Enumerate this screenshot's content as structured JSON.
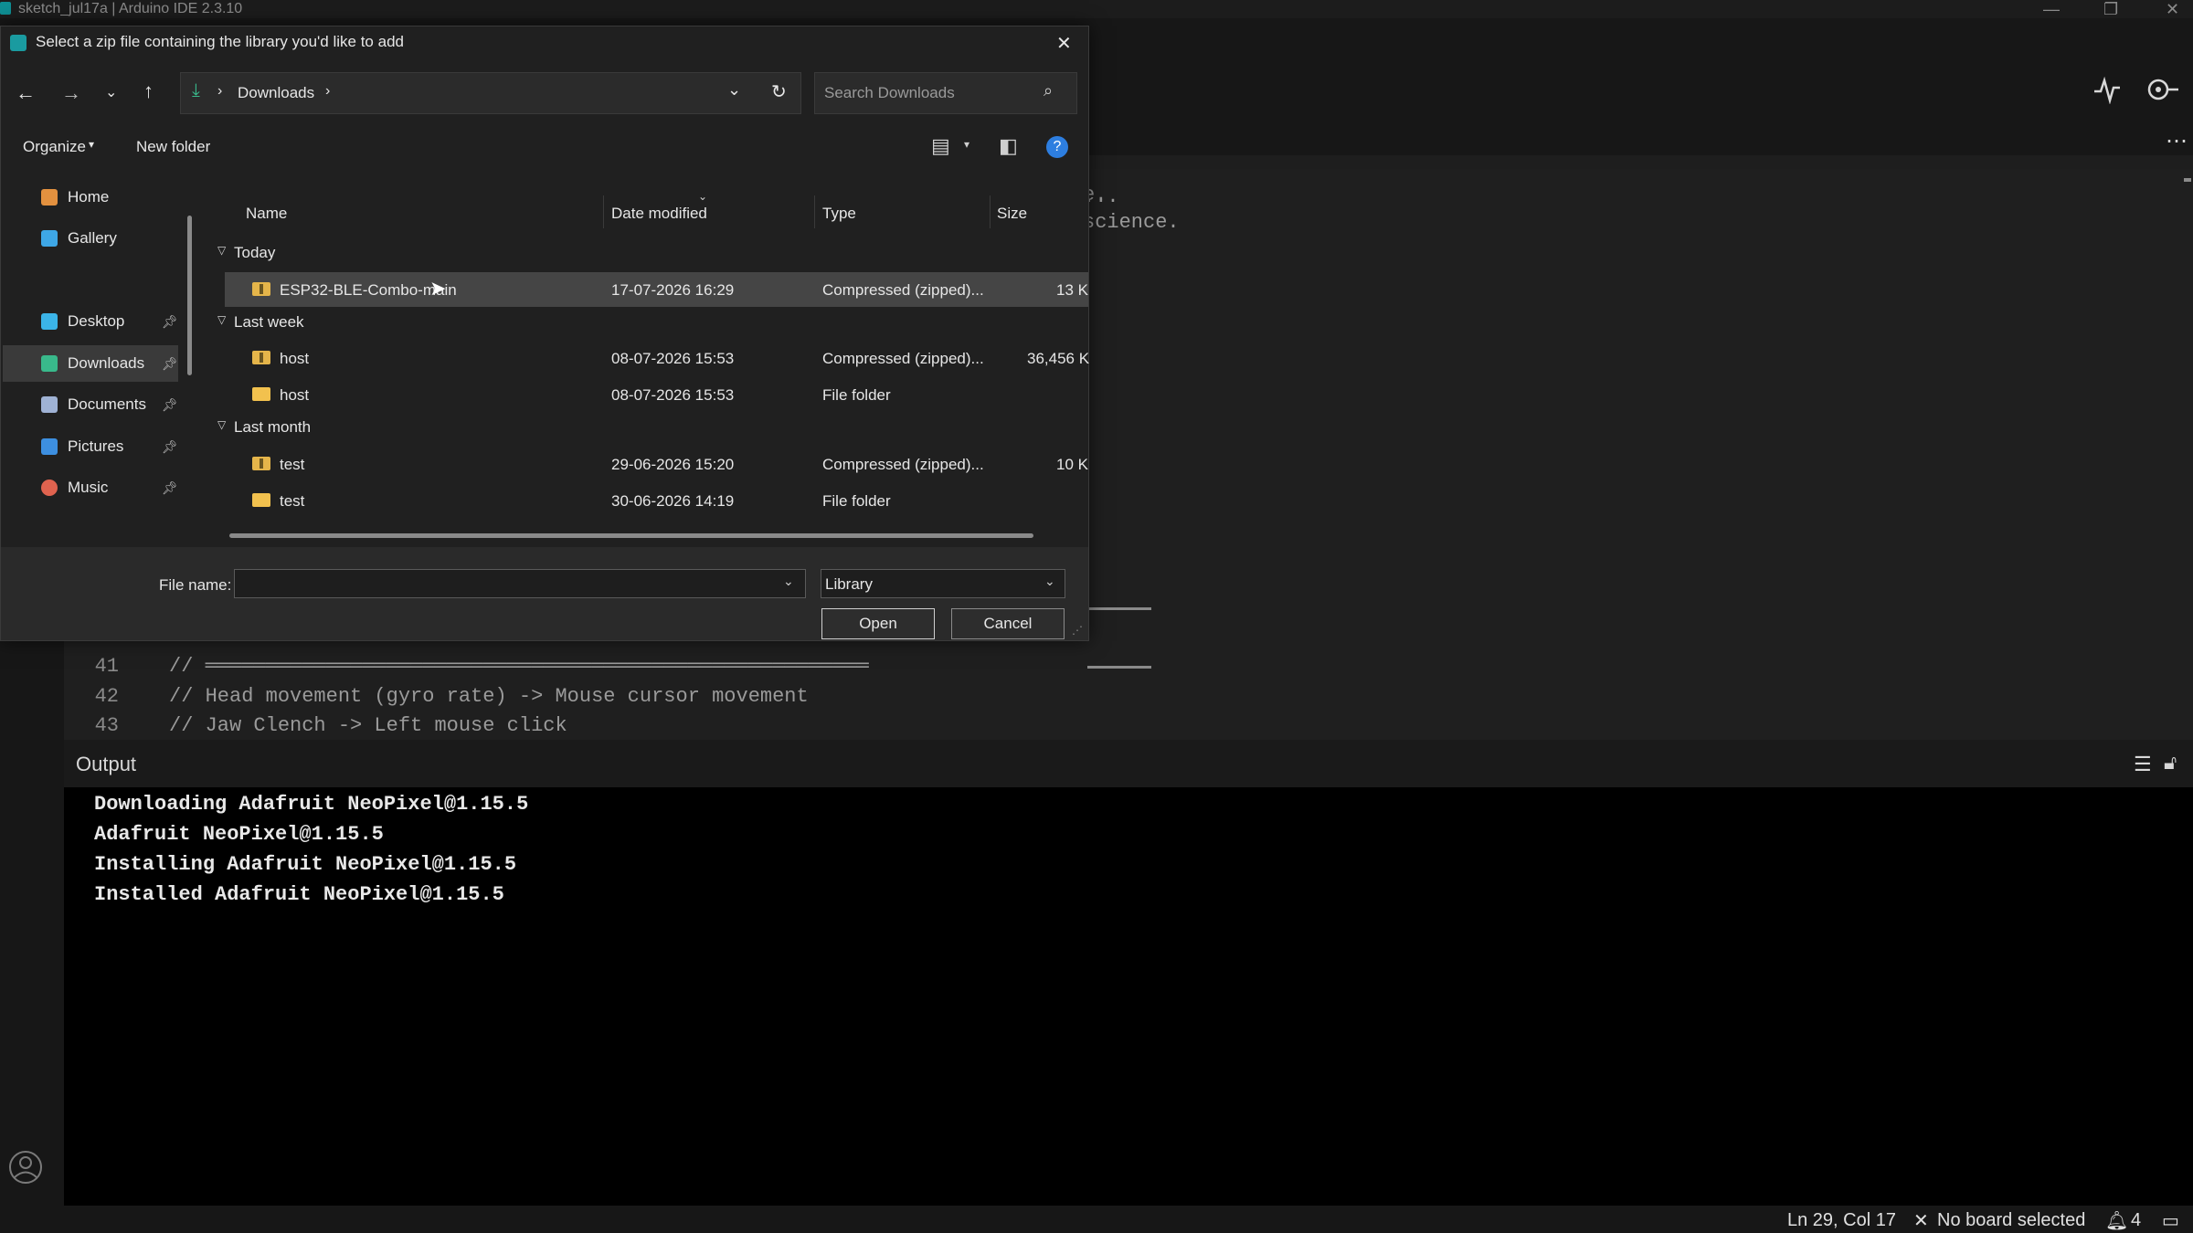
{
  "ide": {
    "window_title": "sketch_jul17a | Arduino IDE 2.3.10",
    "code_lines": [
      {
        "num": "41",
        "text": "// ═══════════════════════════════════════════════════════"
      },
      {
        "num": "42",
        "text": "// Head movement (gyro rate) -> Mouse cursor movement"
      },
      {
        "num": "43",
        "text": "// Jaw Clench -> Left mouse click"
      }
    ],
    "partial_code_1": "e.",
    "partial_code_2": "science.",
    "output_title": "Output",
    "output_lines": [
      "Downloading Adafruit NeoPixel@1.15.5",
      "Adafruit NeoPixel@1.15.5",
      "Installing Adafruit NeoPixel@1.15.5",
      "Installed Adafruit NeoPixel@1.15.5"
    ],
    "status": {
      "cursor": "Ln 29, Col 17",
      "board": "No board selected",
      "notifications": "4"
    }
  },
  "dialog": {
    "title": "Select a zip file containing the library you'd like to add",
    "breadcrumb": "Downloads",
    "search_placeholder": "Search Downloads",
    "organize_label": "Organize",
    "new_folder_label": "New folder",
    "nav": [
      {
        "label": "Home",
        "color": "#e3913f",
        "pinned": false
      },
      {
        "label": "Gallery",
        "color": "#3ea7e6",
        "pinned": false
      },
      {
        "label": "Desktop",
        "color": "#3bb4e8",
        "pinned": true
      },
      {
        "label": "Downloads",
        "color": "#39b98b",
        "pinned": true
      },
      {
        "label": "Documents",
        "color": "#9fb2d4",
        "pinned": true
      },
      {
        "label": "Pictures",
        "color": "#3d8fe0",
        "pinned": true
      },
      {
        "label": "Music",
        "color": "#e0634f",
        "pinned": true
      }
    ],
    "columns": {
      "name": "Name",
      "date": "Date modified",
      "type": "Type",
      "size": "Size"
    },
    "groups": {
      "today": "Today",
      "last_week": "Last week",
      "last_month": "Last month"
    },
    "files": [
      {
        "name": "ESP32-BLE-Combo-main",
        "date": "17-07-2026 16:29",
        "type": "Compressed (zipped)...",
        "size": "13 K"
      },
      {
        "name": "host",
        "date": "08-07-2026 15:53",
        "type": "Compressed (zipped)...",
        "size": "36,456 K"
      },
      {
        "name": "host",
        "date": "08-07-2026 15:53",
        "type": "File folder",
        "size": ""
      },
      {
        "name": "test",
        "date": "29-06-2026 15:20",
        "type": "Compressed (zipped)...",
        "size": "10 K"
      },
      {
        "name": "test",
        "date": "30-06-2026 14:19",
        "type": "File folder",
        "size": ""
      }
    ],
    "file_name_label": "File name:",
    "file_name_value": "",
    "filter_value": "Library",
    "open_label": "Open",
    "cancel_label": "Cancel"
  }
}
